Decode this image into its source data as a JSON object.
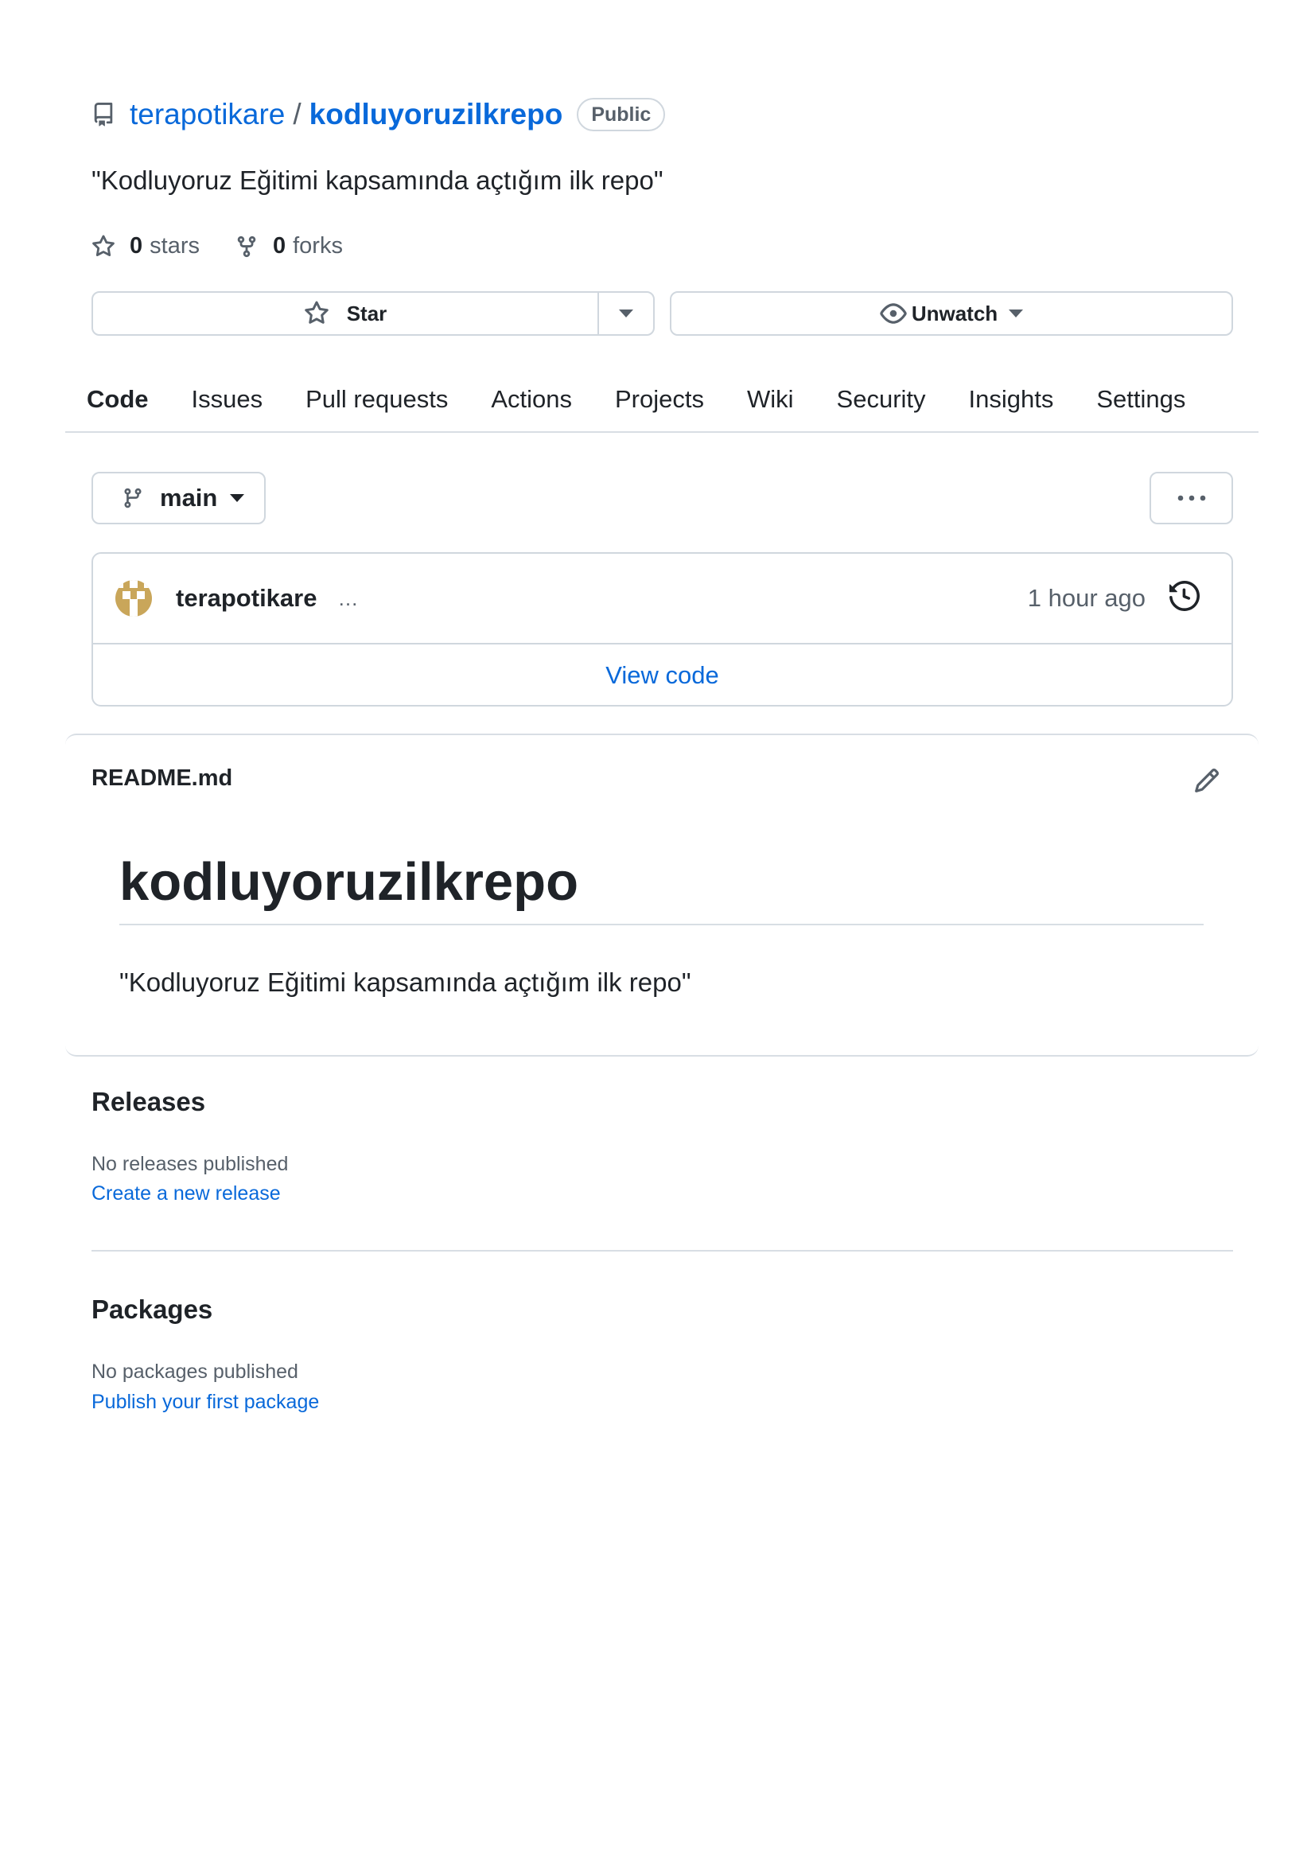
{
  "repo": {
    "owner": "terapotikare",
    "separator": "/",
    "name": "kodluyoruzilkrepo",
    "visibility": "Public",
    "description": "\"Kodluyoruz Eğitimi kapsamında açtığım ilk repo\""
  },
  "stats": {
    "stars_count": "0",
    "stars_label": "stars",
    "forks_count": "0",
    "forks_label": "forks"
  },
  "actions": {
    "star_label": "Star",
    "watch_label": "Unwatch"
  },
  "tabs": [
    {
      "label": "Code",
      "active": true
    },
    {
      "label": "Issues"
    },
    {
      "label": "Pull requests"
    },
    {
      "label": "Actions"
    },
    {
      "label": "Projects"
    },
    {
      "label": "Wiki"
    },
    {
      "label": "Security"
    },
    {
      "label": "Insights"
    },
    {
      "label": "Settings"
    }
  ],
  "branch": {
    "name": "main"
  },
  "more_menu": {
    "label": "···"
  },
  "commit": {
    "author": "terapotikare",
    "message_preview": "…",
    "time": "1 hour ago",
    "view_code_label": "View code"
  },
  "readme": {
    "filename": "README.md",
    "heading": "kodluyoruzilkrepo",
    "body": "\"Kodluyoruz Eğitimi kapsamında açtığım ilk repo\""
  },
  "releases": {
    "title": "Releases",
    "empty_text": "No releases published",
    "link_label": "Create a new release"
  },
  "packages": {
    "title": "Packages",
    "empty_text": "No packages published",
    "link_label": "Publish your first package"
  },
  "icons": {
    "repo": "repo-icon",
    "star": "star-icon",
    "fork": "fork-icon",
    "eye": "eye-icon",
    "branch": "git-branch-icon",
    "history": "history-icon",
    "pencil": "pencil-icon",
    "kebab": "kebab-horizontal-icon"
  },
  "colors": {
    "link": "#0969da",
    "text": "#1f2328",
    "muted": "#57606a",
    "border": "#d0d7de",
    "avatar": "#c9a65a"
  }
}
